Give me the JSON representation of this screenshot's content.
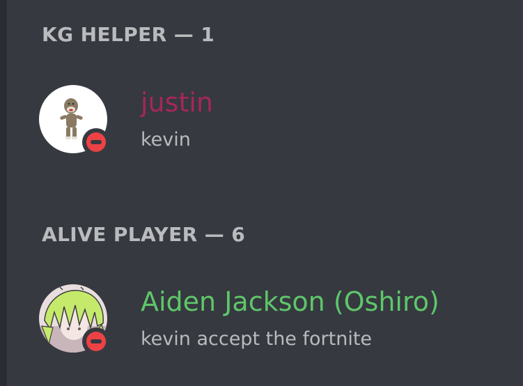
{
  "sections": [
    {
      "header": "KG HELPER — 1",
      "members": [
        {
          "name": "justin",
          "activity": "kevin",
          "name_color": "#a5275a",
          "avatar_icon": "sock-monkey-icon",
          "status_icon": "do-not-disturb-icon"
        }
      ]
    },
    {
      "header": "ALIVE PLAYER — 6",
      "members": [
        {
          "name": "Aiden Jackson (Oshiro)",
          "activity": "kevin accept the fortnite",
          "name_color": "#5ec76a",
          "avatar_icon": "anime-character-icon",
          "status_icon": "do-not-disturb-icon"
        }
      ]
    }
  ],
  "colors": {
    "background": "#36393f",
    "header_text": "#b9bbbe",
    "activity_text": "#b9bbbe",
    "dnd_red": "#ed4245"
  }
}
